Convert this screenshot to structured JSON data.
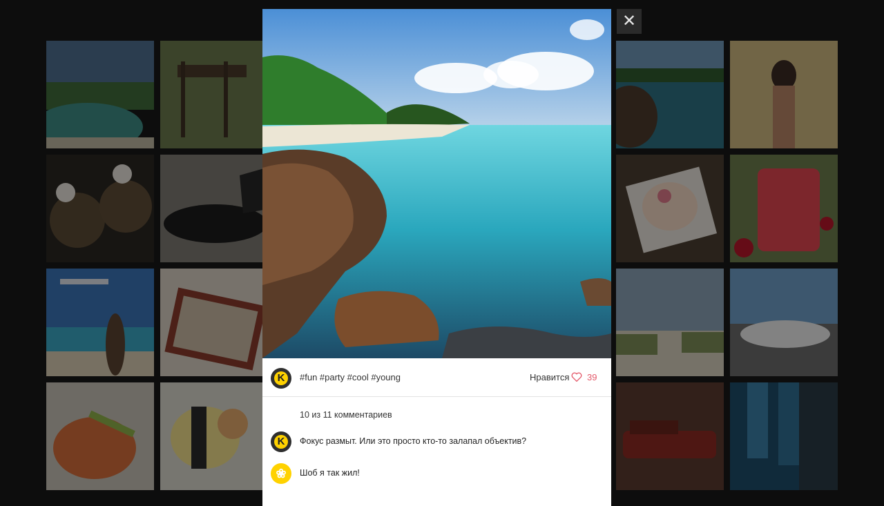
{
  "overlay": {
    "close_icon": "close-icon",
    "close_glyph": "✕"
  },
  "post": {
    "author_logo_letter": "K",
    "tags": "#fun #party #cool #young",
    "like_label": "Нравится",
    "like_count": "39",
    "heart_icon": "heart-outline-icon",
    "accent_color": "#e45a6b",
    "brand_color": "#ffd200"
  },
  "comments": {
    "summary": "10 из 11 комментариев",
    "items": [
      {
        "avatar_letter": "K",
        "avatar": "k-logo-avatar",
        "text": "Фокус размыт. Или это просто кто-то залапал объектив?"
      },
      {
        "avatar_letter": "❀",
        "avatar": "flower-avatar",
        "text": "Шоб я так жил!"
      }
    ]
  },
  "background_grid": {
    "tiles": [
      "beach-lagoon",
      "go-to-the-beach-sign",
      "snowman-soup-bowls",
      "sports-car-open-doors",
      "plane-over-beach",
      "tray-of-food",
      "sushi-plate",
      "cat-sushi",
      "coast-rocks",
      "woman-with-camera",
      "dessert-plate",
      "pink-drink",
      "dunes",
      "white-car",
      "red-vintage-car",
      "legs-on-floor"
    ]
  }
}
